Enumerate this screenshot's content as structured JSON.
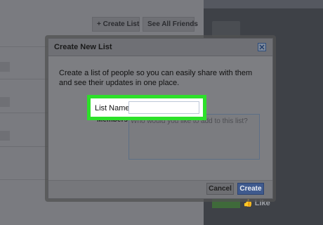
{
  "background": {
    "create_list_label": "+ Create List",
    "see_all_friends_label": "See All Friends",
    "like_label": "Like"
  },
  "dialog": {
    "title": "Create New List",
    "description": "Create a list of people so you can easily share with them and see their updates in one place.",
    "list_name_label": "List Name",
    "list_name_value": "",
    "members_label": "Members",
    "members_placeholder": "Who would you like to add to this list?",
    "cancel_label": "Cancel",
    "create_label": "Create"
  },
  "colors": {
    "highlight": "#2de02a",
    "create_button": "#3f5a8e"
  }
}
